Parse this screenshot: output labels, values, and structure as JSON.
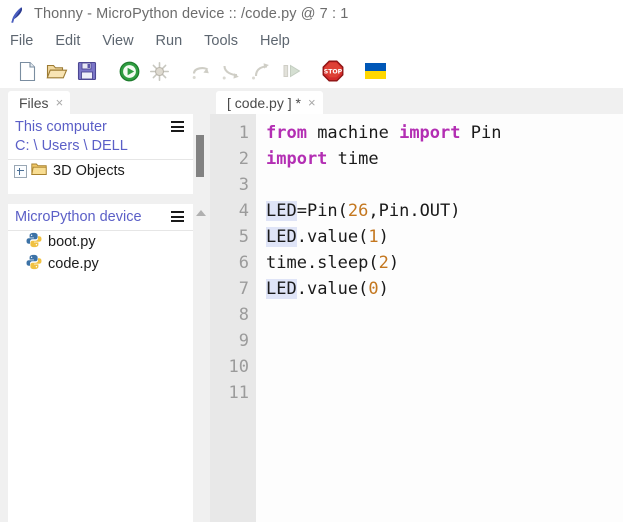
{
  "window": {
    "title": "Thonny  -  MicroPython device :: /code.py  @  7 : 1",
    "logo_icon": "thonny-feather-icon"
  },
  "menubar": {
    "items": [
      {
        "label": "File"
      },
      {
        "label": "Edit"
      },
      {
        "label": "View"
      },
      {
        "label": "Run"
      },
      {
        "label": "Tools"
      },
      {
        "label": "Help"
      }
    ]
  },
  "toolbar": {
    "buttons": [
      {
        "name": "new-file-button",
        "icon": "new-file-icon",
        "enabled": true
      },
      {
        "name": "open-file-button",
        "icon": "open-folder-icon",
        "enabled": true
      },
      {
        "name": "save-file-button",
        "icon": "save-disk-icon",
        "enabled": true
      },
      {
        "name": "run-button",
        "icon": "run-play-icon",
        "enabled": true
      },
      {
        "name": "debug-button",
        "icon": "debug-bug-icon",
        "enabled": false
      },
      {
        "name": "step-over-button",
        "icon": "step-over-icon",
        "enabled": false
      },
      {
        "name": "step-into-button",
        "icon": "step-into-icon",
        "enabled": false
      },
      {
        "name": "step-out-button",
        "icon": "step-out-icon",
        "enabled": false
      },
      {
        "name": "resume-button",
        "icon": "resume-icon",
        "enabled": false
      },
      {
        "name": "stop-button",
        "icon": "stop-sign-icon",
        "enabled": true
      },
      {
        "name": "ukraine-flag-button",
        "icon": "ukraine-flag-icon",
        "enabled": true
      }
    ],
    "stop_label": "STOP"
  },
  "files_panel": {
    "tab": {
      "label": "Files",
      "close": "×"
    },
    "this_computer": {
      "title": "This computer",
      "path": "C: \\ Users \\ DELL",
      "menu_icon": "hamburger-menu-icon",
      "entries": [
        {
          "label": "3D Objects",
          "icon": "folder-icon",
          "expandable": true
        }
      ]
    },
    "micropython_device": {
      "title": "MicroPython device",
      "menu_icon": "hamburger-menu-icon",
      "entries": [
        {
          "label": "boot.py",
          "icon": "python-file-icon"
        },
        {
          "label": "code.py",
          "icon": "python-file-icon"
        }
      ]
    }
  },
  "editor": {
    "tab": {
      "label": "[ code.py ] *",
      "close": "×"
    },
    "line_numbers": [
      "1",
      "2",
      "3",
      "4",
      "5",
      "6",
      "7",
      "8",
      "9",
      "10",
      "11"
    ],
    "lines": [
      {
        "n": 1,
        "tokens": [
          {
            "t": "from",
            "c": "kw"
          },
          {
            "t": " machine ",
            "c": ""
          },
          {
            "t": "import",
            "c": "kw"
          },
          {
            "t": " Pin",
            "c": ""
          }
        ]
      },
      {
        "n": 2,
        "tokens": [
          {
            "t": "import",
            "c": "kw"
          },
          {
            "t": " time",
            "c": ""
          }
        ]
      },
      {
        "n": 3,
        "tokens": []
      },
      {
        "n": 4,
        "tokens": [
          {
            "t": "LED",
            "c": "hl"
          },
          {
            "t": "=Pin(",
            "c": ""
          },
          {
            "t": "26",
            "c": "num"
          },
          {
            "t": ",Pin.OUT)",
            "c": ""
          }
        ]
      },
      {
        "n": 5,
        "tokens": [
          {
            "t": "LED",
            "c": "hl"
          },
          {
            "t": ".value(",
            "c": ""
          },
          {
            "t": "1",
            "c": "num"
          },
          {
            "t": ")",
            "c": ""
          }
        ]
      },
      {
        "n": 6,
        "tokens": [
          {
            "t": "time.sleep(",
            "c": ""
          },
          {
            "t": "2",
            "c": "num"
          },
          {
            "t": ")",
            "c": ""
          }
        ]
      },
      {
        "n": 7,
        "tokens": [
          {
            "t": "LED",
            "c": "hl"
          },
          {
            "t": ".value(",
            "c": ""
          },
          {
            "t": "0",
            "c": "num"
          },
          {
            "t": ")",
            "c": ""
          }
        ]
      },
      {
        "n": 8,
        "tokens": []
      },
      {
        "n": 9,
        "tokens": []
      },
      {
        "n": 10,
        "tokens": []
      },
      {
        "n": 11,
        "tokens": []
      }
    ]
  },
  "colors": {
    "keyword": "#b32eb3",
    "number": "#c4771f",
    "panel_title": "#5b5fc7",
    "gutter_bg": "#e8e8e8",
    "selection": "#dfe4f7",
    "run_green": "#2f9e41",
    "stop_red": "#d22b2b",
    "flag_blue": "#0057b7",
    "flag_yellow": "#ffd700"
  }
}
